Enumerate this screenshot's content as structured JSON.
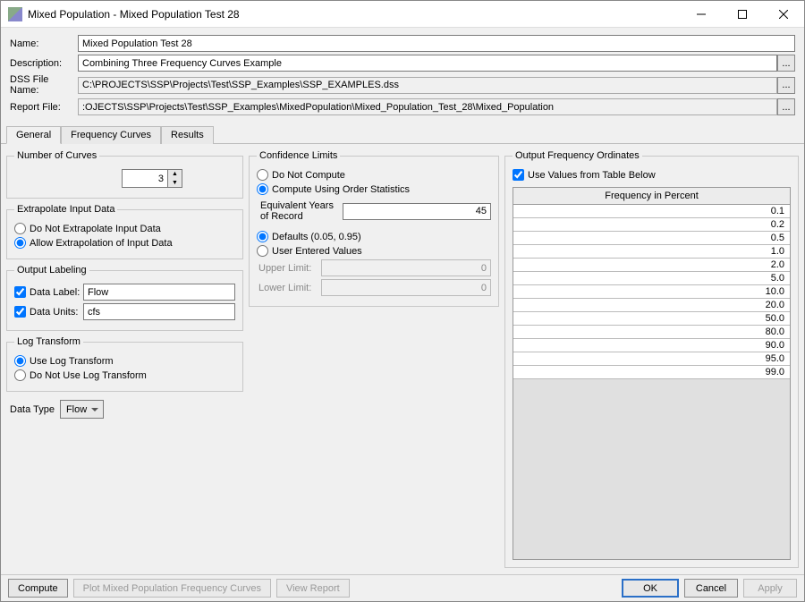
{
  "window": {
    "title": "Mixed Population - Mixed Population Test 28"
  },
  "form": {
    "name_label": "Name:",
    "name_value": "Mixed Population Test 28",
    "desc_label": "Description:",
    "desc_value": "Combining Three Frequency Curves Example",
    "dss_label": "DSS File Name:",
    "dss_value": "C:\\PROJECTS\\SSP\\Projects\\Test\\SSP_Examples\\SSP_EXAMPLES.dss",
    "report_label": "Report File:",
    "report_value": ":OJECTS\\SSP\\Projects\\Test\\SSP_Examples\\MixedPopulation\\Mixed_Population_Test_28\\Mixed_Population",
    "ellipsis": "..."
  },
  "tabs": {
    "general": "General",
    "freq": "Frequency Curves",
    "results": "Results"
  },
  "general": {
    "num_curves_legend": "Number of Curves",
    "num_curves_value": "3",
    "extrap_legend": "Extrapolate Input Data",
    "extrap_no": "Do Not Extrapolate Input Data",
    "extrap_yes": "Allow Extrapolation of Input Data",
    "outlabel_legend": "Output Labeling",
    "data_label_label": "Data Label:",
    "data_label_value": "Flow",
    "data_units_label": "Data Units:",
    "data_units_value": "cfs",
    "log_legend": "Log Transform",
    "log_yes": "Use Log Transform",
    "log_no": "Do Not Use Log Transform",
    "datatype_label": "Data Type",
    "datatype_value": "Flow"
  },
  "confidence": {
    "legend": "Confidence Limits",
    "do_not_compute": "Do Not Compute",
    "compute_order": "Compute Using Order Statistics",
    "equiv_label": "Equivalent Years of Record",
    "equiv_value": "45",
    "defaults": "Defaults (0.05, 0.95)",
    "user_entered": "User Entered Values",
    "upper_label": "Upper Limit:",
    "upper_value": "0",
    "lower_label": "Lower Limit:",
    "lower_value": "0"
  },
  "ordinates": {
    "legend": "Output Frequency Ordinates",
    "use_values_label": "Use Values from Table Below",
    "col_header": "Frequency in Percent",
    "rows": [
      "0.1",
      "0.2",
      "0.5",
      "1.0",
      "2.0",
      "5.0",
      "10.0",
      "20.0",
      "50.0",
      "80.0",
      "90.0",
      "95.0",
      "99.0"
    ]
  },
  "footer": {
    "compute": "Compute",
    "plot": "Plot Mixed Population Frequency Curves",
    "view_report": "View Report",
    "ok": "OK",
    "cancel": "Cancel",
    "apply": "Apply"
  }
}
